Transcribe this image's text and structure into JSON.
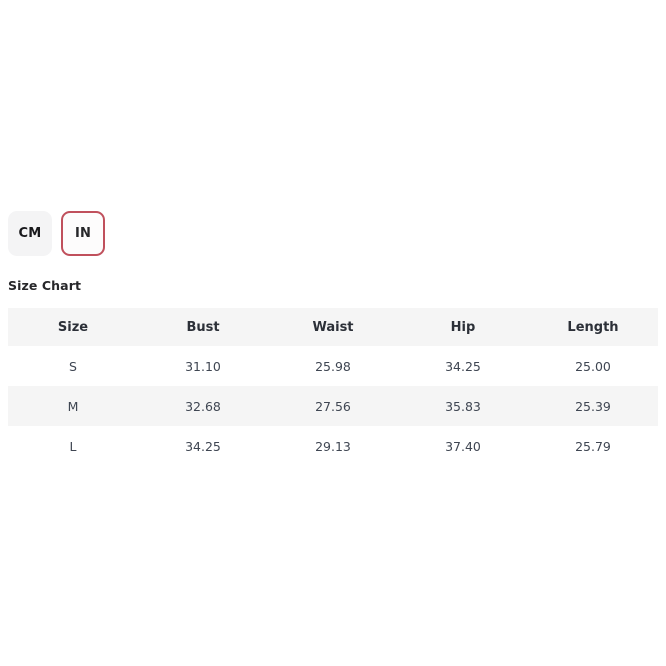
{
  "units": {
    "label": "unit-toggle",
    "options": [
      {
        "label": "CM",
        "selected": false
      },
      {
        "label": "IN",
        "selected": true
      }
    ],
    "selected": "IN",
    "active_border_color": "#c0505c",
    "inactive_bg_color": "#f4f4f5"
  },
  "size_chart": {
    "title": "Size Chart",
    "columns": [
      "Size",
      "Bust",
      "Waist",
      "Hip",
      "Length"
    ],
    "rows": [
      {
        "size": "S",
        "bust": "31.10",
        "waist": "25.98",
        "hip": "34.25",
        "length": "25.00"
      },
      {
        "size": "M",
        "bust": "32.68",
        "waist": "27.56",
        "hip": "35.83",
        "length": "25.39"
      },
      {
        "size": "L",
        "bust": "34.25",
        "waist": "29.13",
        "hip": "37.40",
        "length": "25.79"
      }
    ],
    "header_bg_color": "#f5f5f5",
    "stripe_bg_color": "#f5f5f5"
  }
}
